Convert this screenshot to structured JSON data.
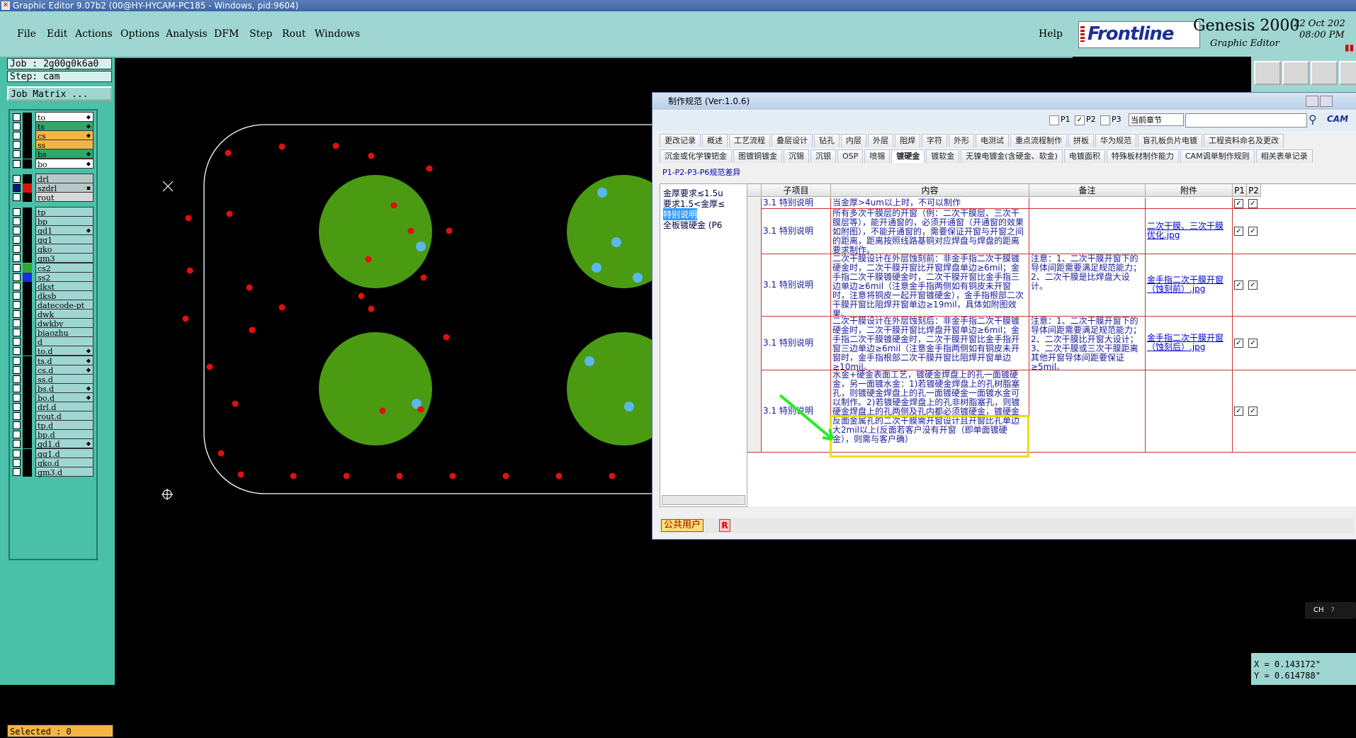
{
  "window": {
    "title": "Graphic Editor 9.07b2 (00@HY-HYCAM-PC185 - Windows, pid:9604)"
  },
  "menu": [
    "File",
    "Edit",
    "Actions",
    "Options",
    "Analysis",
    "DFM",
    "Step",
    "Rout",
    "Windows"
  ],
  "help": "Help",
  "brand": {
    "logo": "Frontline",
    "product": "Genesis 2000",
    "subtitle": "Graphic Editor",
    "date": "22 Oct 202",
    "time": "08:00 PM"
  },
  "job": {
    "job_label": "Job : 2g00g0k6a0",
    "step_label": "Step: cam",
    "matrix_button": "Job Matrix ..."
  },
  "layers": [
    {
      "name": "to",
      "color": "#ffffff",
      "mark": "⬥"
    },
    {
      "name": "ts",
      "color": "#2fa86a",
      "mark": "⬥"
    },
    {
      "name": "cs",
      "color": "#f4b642",
      "mark": "⬥"
    },
    {
      "name": "ss",
      "color": "#f4b642",
      "mark": ""
    },
    {
      "name": "bs",
      "color": "#2fa86a",
      "mark": "⬥"
    },
    {
      "name": "bo",
      "color": "#ffffff",
      "mark": "⬥"
    },
    {
      "name": "drl",
      "color": "#b8c8c8",
      "mark": ""
    },
    {
      "name": "szdrl",
      "color": "#b8c8c8",
      "mark": "▪"
    },
    {
      "name": "rout",
      "color": "#d8d8d8",
      "mark": ""
    },
    {
      "name": "tp",
      "color": "#9fd6d2",
      "mark": ""
    },
    {
      "name": "bp",
      "color": "#9fd6d2",
      "mark": ""
    },
    {
      "name": "gd1",
      "color": "#9fd6d2",
      "mark": "⬥"
    },
    {
      "name": "gg1",
      "color": "#9fd6d2",
      "mark": ""
    },
    {
      "name": "gko",
      "color": "#9fd6d2",
      "mark": ""
    },
    {
      "name": "gm3",
      "color": "#9fd6d2",
      "mark": ""
    },
    {
      "name": "cs2",
      "color": "#9fd6d2",
      "mark": ""
    },
    {
      "name": "ss2",
      "color": "#9fd6d2",
      "mark": ""
    },
    {
      "name": "dkst",
      "color": "#9fd6d2",
      "mark": ""
    },
    {
      "name": "dksb",
      "color": "#9fd6d2",
      "mark": ""
    },
    {
      "name": "datecode-pt",
      "color": "#9fd6d2",
      "mark": ""
    },
    {
      "name": "dwk",
      "color": "#9fd6d2",
      "mark": ""
    },
    {
      "name": "dwkby",
      "color": "#9fd6d2",
      "mark": ""
    },
    {
      "name": "biaozhu",
      "color": "#9fd6d2",
      "mark": ""
    },
    {
      "name": "d",
      "color": "#9fd6d2",
      "mark": ""
    },
    {
      "name": "to.d",
      "color": "#9fd6d2",
      "mark": "⬥"
    },
    {
      "name": "ts.d",
      "color": "#9fd6d2",
      "mark": "⬥"
    },
    {
      "name": "cs.d",
      "color": "#9fd6d2",
      "mark": "⬥"
    },
    {
      "name": "ss.d",
      "color": "#9fd6d2",
      "mark": ""
    },
    {
      "name": "bs.d",
      "color": "#9fd6d2",
      "mark": "⬥"
    },
    {
      "name": "bo.d",
      "color": "#9fd6d2",
      "mark": "⬥"
    },
    {
      "name": "drl.d",
      "color": "#9fd6d2",
      "mark": ""
    },
    {
      "name": "rout.d",
      "color": "#9fd6d2",
      "mark": ""
    },
    {
      "name": "tp.d",
      "color": "#9fd6d2",
      "mark": ""
    },
    {
      "name": "bp.d",
      "color": "#9fd6d2",
      "mark": ""
    },
    {
      "name": "gd1.d",
      "color": "#9fd6d2",
      "mark": "⬥"
    },
    {
      "name": "gg1.d",
      "color": "#9fd6d2",
      "mark": ""
    },
    {
      "name": "gko.d",
      "color": "#9fd6d2",
      "mark": ""
    },
    {
      "name": "gm3.d",
      "color": "#9fd6d2",
      "mark": ""
    }
  ],
  "selected": "Selected : 0",
  "coords": {
    "x": "X = 0.143172\"",
    "y": "Y = 0.614788\""
  },
  "dialog": {
    "title": "制作规范 (Ver:1.0.6)",
    "toolbar": {
      "p1": "P1",
      "p2": "P2",
      "p3": "P3",
      "chapter": "当前章节",
      "cam": "CAM"
    },
    "tabs_row1": [
      "更改记录",
      "概述",
      "工艺流程",
      "叠层设计",
      "钻孔",
      "内层",
      "外层",
      "阻焊",
      "字符",
      "外形",
      "电测试",
      "重点流程制作",
      "拼板",
      "华为规范",
      "盲孔板负片电镀",
      "工程资料命名及更改"
    ],
    "tabs_row2": [
      "沉金或化学镍钯金",
      "图镀铜镀金",
      "沉锡",
      "沉银",
      "OSP",
      "喷锡",
      "镀硬金",
      "镀软金",
      "无镍电镀金(含硬金、软金)",
      "电镀面积",
      "特殊板材制作能力",
      "CAM调单制作规则",
      "相关表单记录"
    ],
    "active_tab": "镀硬金",
    "subheading": "P1-P2-P3-P6规范差异",
    "tree": [
      "金厚要求≤1.5u",
      "要求1.5<金厚≤",
      "特别说明",
      "全板镀硬金 (P6"
    ],
    "tree_selected": "特别说明",
    "headers": [
      "子项目",
      "内容",
      "备注",
      "附件",
      "P1",
      "P2"
    ],
    "rows": [
      {
        "sub": "3.1 特别说明",
        "content": "当金厚>4um以上时，不可以制作",
        "note": "",
        "attach": ""
      },
      {
        "sub": "3.1 特别说明",
        "content": "所有多次干膜层的开窗（例：二次干膜层、三次干膜层等），能开通窗的，必须开通窗（开通窗的效果如附图），不能开通窗的，需要保证开窗与开窗之间的距离，距离按照线路基铜对应焊盘与焊盘的距离要求制作。",
        "note": "",
        "attach": "二次干膜、三次干膜优化.jpg"
      },
      {
        "sub": "3.1 特别说明",
        "content": "二次干膜设计在外层蚀刻前：非金手指二次干膜镀硬金时，二次干膜开窗比开窗焊盘单边≥6mil；金手指二次干膜镀硬金时，二次干膜开窗比金手指三边单边≥6mil（注意金手指两侧如有铜皮未开窗时，注意将铜皮一起开窗镀硬金），金手指根部二次干膜开窗比阻焊开窗单边≥19mil，具体如附图效果。",
        "note": "注意：1、二次干膜开窗下的导体间距需要满足规范能力；2、二次干膜是比焊盘大设计。",
        "attach": "金手指二次干膜开窗（蚀刻前）.jpg"
      },
      {
        "sub": "3.1 特别说明",
        "content": "二次干膜设计在外层蚀刻后：非金手指二次干膜镀硬金时，二次干膜开窗比焊盘开窗单边≥6mil；金手指二次干膜镀硬金时，二次干膜开窗比金手指开窗三边单边≥6mil（注意金手指两侧如有铜皮未开窗时，金手指根部二次干膜开窗比阻焊开窗单边≥10mil。",
        "note": "注意：1、二次干膜开窗下的导体间距需要满足规范能力；2、二次干膜比开窗大设计；3、二次干膜或三次干膜距离其他开窗导体间距要保证≥5mil。",
        "attach": "金手指二次干膜开窗（蚀刻后）.jpg"
      },
      {
        "sub": "3.1 特别说明",
        "content": "水金+硬金表面工艺，镀硬金焊盘上的孔一面镀硬金，另一面镀水金：1)若镀硬金焊盘上的孔树脂塞孔，则镀硬金焊盘上的孔一面镀硬金一面镀水金可以制作。2)若镀硬金焊盘上的孔非树脂塞孔，则镀硬金焊盘上的孔两侧及孔内都必须镀硬金，镀硬金反面金属孔的二次干膜需开窗设计且开窗比孔单边大2mil以上(反面若客户没有开窗（即单面镀硬金），则需与客户确）",
        "note": "",
        "attach": ""
      }
    ],
    "status": {
      "user": "公共用户",
      "r": "R"
    }
  },
  "ime": "CH",
  "colors": {
    "menubar": "#9fd6d2",
    "panel": "#4bc0a8",
    "pad": "#4a9a12",
    "hole": "#5ab8ef",
    "dot": "#e01010",
    "highlight": "#e8e000",
    "arrow": "#22ee22"
  }
}
